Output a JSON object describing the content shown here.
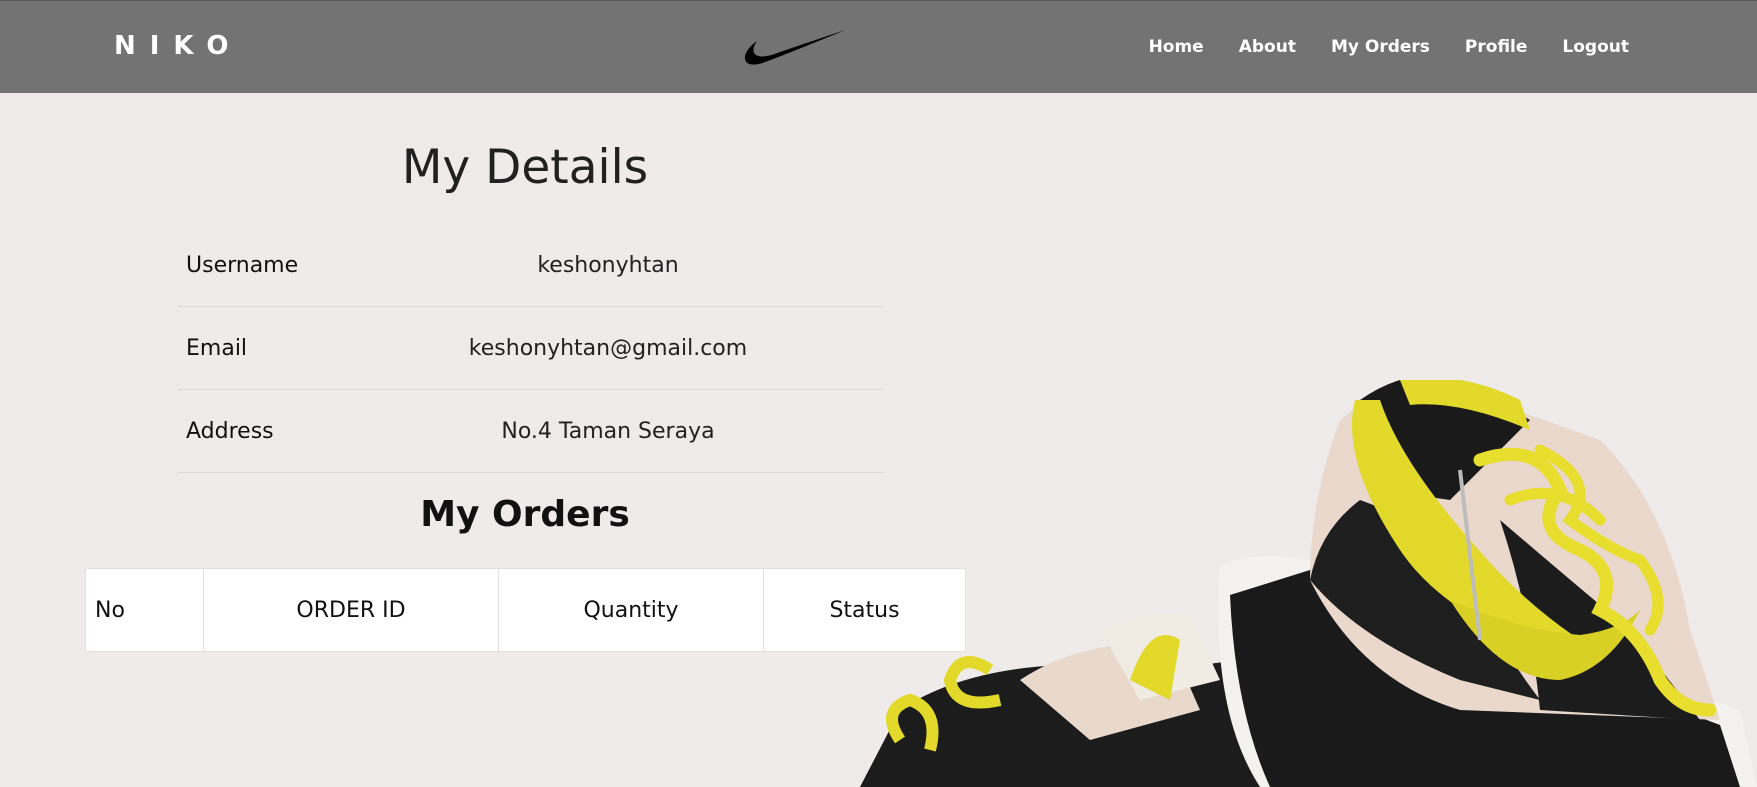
{
  "navbar": {
    "brand": "NIKO",
    "logo_icon": "swoosh-icon",
    "links": [
      "Home",
      "About",
      "My Orders",
      "Profile",
      "Logout"
    ]
  },
  "details": {
    "title": "My Details",
    "rows": [
      {
        "label": "Username",
        "value": "keshonyhtan"
      },
      {
        "label": "Email",
        "value": "keshonyhtan@gmail.com"
      },
      {
        "label": "Address",
        "value": "No.4 Taman Seraya"
      }
    ]
  },
  "orders": {
    "title": "My Orders",
    "columns": [
      "No",
      "ORDER ID",
      "Quantity",
      "Status"
    ],
    "rows": []
  },
  "colors": {
    "navbar": "#737373",
    "background": "#eeebea",
    "shoe_accent": "#e2d92a"
  },
  "hero_image": "sneaker-image"
}
